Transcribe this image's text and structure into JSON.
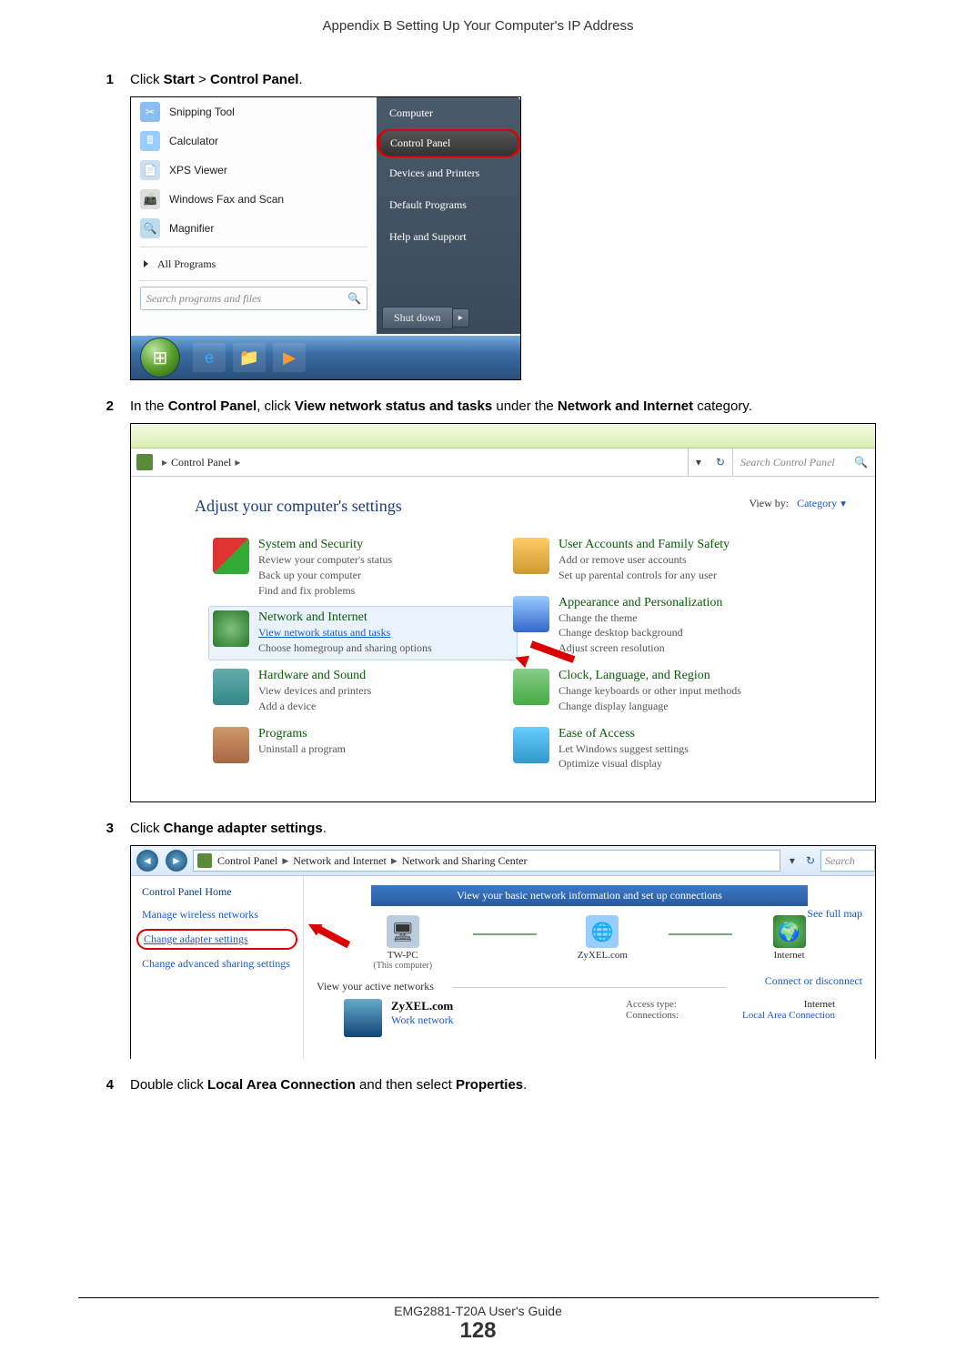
{
  "header": "Appendix B Setting Up Your Computer's IP Address",
  "footer": {
    "guide": "EMG2881-T20A User's Guide",
    "page": "128"
  },
  "steps": {
    "s1": {
      "num": "1",
      "pre": "Click ",
      "b1": "Start",
      "mid": " > ",
      "b2": "Control Panel",
      "post": "."
    },
    "s2": {
      "num": "2",
      "pre": "In the ",
      "b1": "Control Panel",
      "mid1": ", click ",
      "b2": "View network status and tasks",
      "mid2": " under the ",
      "b3": "Network and Internet",
      "post": " category."
    },
    "s3": {
      "num": "3",
      "pre": "Click ",
      "b1": "Change adapter settings",
      "post": "."
    },
    "s4": {
      "num": "4",
      "pre": "Double click ",
      "b1": "Local Area Connection",
      "mid": " and then select ",
      "b2": "Properties",
      "post": "."
    }
  },
  "ss1": {
    "left_items": [
      "Snipping Tool",
      "Calculator",
      "XPS Viewer",
      "Windows Fax and Scan",
      "Magnifier"
    ],
    "all_programs": "All Programs",
    "search_placeholder": "Search programs and files",
    "right_items": [
      "Computer",
      "Control Panel",
      "Devices and Printers",
      "Default Programs",
      "Help and Support"
    ],
    "shutdown": "Shut down"
  },
  "ss2": {
    "breadcrumb": "Control Panel",
    "search_placeholder": "Search Control Panel",
    "heading": "Adjust your computer's settings",
    "viewby_label": "View by:",
    "viewby_value": "Category",
    "left": [
      {
        "title": "System and Security",
        "links": [
          "Review your computer's status",
          "Back up your computer",
          "Find and fix problems"
        ]
      },
      {
        "title": "Network and Internet",
        "links": [
          "View network status and tasks",
          "Choose homegroup and sharing options"
        ]
      },
      {
        "title": "Hardware and Sound",
        "links": [
          "View devices and printers",
          "Add a device"
        ]
      },
      {
        "title": "Programs",
        "links": [
          "Uninstall a program"
        ]
      }
    ],
    "right": [
      {
        "title": "User Accounts and Family Safety",
        "links": [
          "Add or remove user accounts",
          "Set up parental controls for any user"
        ]
      },
      {
        "title": "Appearance and Personalization",
        "links": [
          "Change the theme",
          "Change desktop background",
          "Adjust screen resolution"
        ]
      },
      {
        "title": "Clock, Language, and Region",
        "links": [
          "Change keyboards or other input methods",
          "Change display language"
        ]
      },
      {
        "title": "Ease of Access",
        "links": [
          "Let Windows suggest settings",
          "Optimize visual display"
        ]
      }
    ]
  },
  "ss3": {
    "crumbs": [
      "Control Panel",
      "Network and Internet",
      "Network and Sharing Center"
    ],
    "search_placeholder": "Search",
    "side": {
      "home": "Control Panel Home",
      "links": [
        "Manage wireless networks",
        "Change adapter settings",
        "Change advanced sharing settings"
      ]
    },
    "title": "View your basic network information and set up connections",
    "full_map": "See full map",
    "connect": "Connect or disconnect",
    "nodes": {
      "pc": "TW-PC",
      "pc_sub": "(This computer)",
      "net": "ZyXEL.com",
      "inet": "Internet"
    },
    "active_label": "View your active networks",
    "active": {
      "name": "ZyXEL.com",
      "type": "Work network",
      "access_lbl": "Access type:",
      "access_val": "Internet",
      "conn_lbl": "Connections:",
      "conn_val": "Local Area Connection"
    }
  }
}
